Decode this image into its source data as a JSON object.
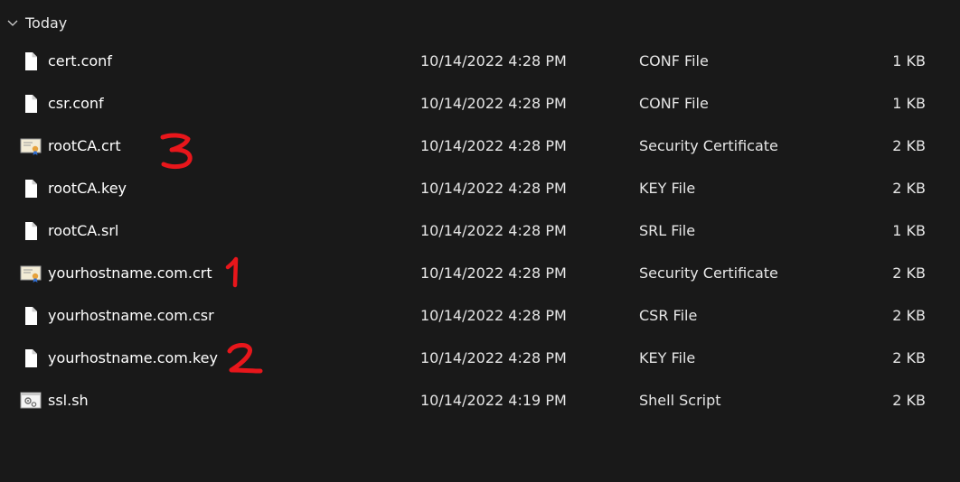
{
  "group": {
    "label": "Today",
    "icon": "chevron-down-icon"
  },
  "files": [
    {
      "name": "cert.conf",
      "date": "10/14/2022 4:28 PM",
      "type": "CONF File",
      "size": "1 KB",
      "icon": "file-icon"
    },
    {
      "name": "csr.conf",
      "date": "10/14/2022 4:28 PM",
      "type": "CONF File",
      "size": "1 KB",
      "icon": "file-icon"
    },
    {
      "name": "rootCA.crt",
      "date": "10/14/2022 4:28 PM",
      "type": "Security Certificate",
      "size": "2 KB",
      "icon": "certificate-icon"
    },
    {
      "name": "rootCA.key",
      "date": "10/14/2022 4:28 PM",
      "type": "KEY File",
      "size": "2 KB",
      "icon": "file-icon"
    },
    {
      "name": "rootCA.srl",
      "date": "10/14/2022 4:28 PM",
      "type": "SRL File",
      "size": "1 KB",
      "icon": "file-icon"
    },
    {
      "name": "yourhostname.com.crt",
      "date": "10/14/2022 4:28 PM",
      "type": "Security Certificate",
      "size": "2 KB",
      "icon": "certificate-icon"
    },
    {
      "name": "yourhostname.com.csr",
      "date": "10/14/2022 4:28 PM",
      "type": "CSR File",
      "size": "2 KB",
      "icon": "file-icon"
    },
    {
      "name": "yourhostname.com.key",
      "date": "10/14/2022 4:28 PM",
      "type": "KEY File",
      "size": "2 KB",
      "icon": "file-icon"
    },
    {
      "name": "ssl.sh",
      "date": "10/14/2022 4:19 PM",
      "type": "Shell Script",
      "size": "2 KB",
      "icon": "shell-script-icon"
    }
  ],
  "annotations": {
    "color": "#e8161b",
    "marks": [
      "3",
      "1",
      "2"
    ]
  }
}
